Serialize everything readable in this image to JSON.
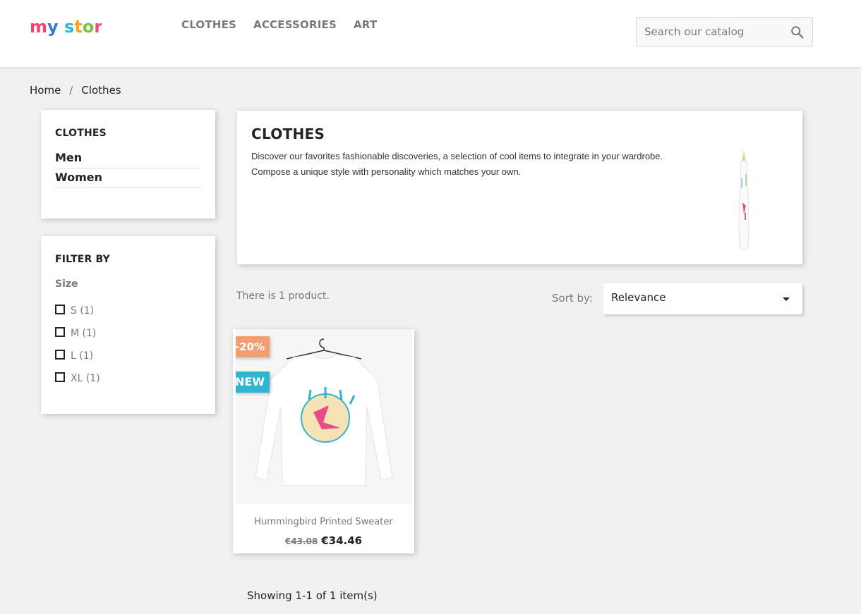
{
  "header": {
    "logo_text": "my store",
    "nav": [
      "CLOTHES",
      "ACCESSORIES",
      "ART"
    ],
    "search_placeholder": "Search our catalog"
  },
  "breadcrumb": [
    "Home",
    "Clothes"
  ],
  "sidebar": {
    "category_title": "CLOTHES",
    "subcategories": [
      "Men",
      "Women"
    ],
    "filter_title": "FILTER BY",
    "facet_title": "Size",
    "facet_options": [
      {
        "label": "S (1)",
        "checked": false
      },
      {
        "label": "M (1)",
        "checked": false
      },
      {
        "label": "L (1)",
        "checked": false
      },
      {
        "label": "XL (1)",
        "checked": false
      }
    ]
  },
  "category": {
    "title": "CLOTHES",
    "description": "Discover our favorites fashionable discoveries, a selection of cool items to integrate in your wardrobe. Compose a unique style with personality which matches your own."
  },
  "listing": {
    "count_text": "There is 1 product.",
    "sort_label": "Sort by:",
    "sort_value": "Relevance",
    "pagination_text": "Showing 1-1 of 1 item(s)"
  },
  "products": [
    {
      "name": "Hummingbird Printed Sweater",
      "old_price": "€43.08",
      "price": "€34.46",
      "flags": [
        "-20%",
        "NEW"
      ]
    }
  ],
  "colors": {
    "accent": "#2fb5d2",
    "discount": "#f39d72",
    "text": "#232323",
    "muted": "#7a7a7a"
  }
}
